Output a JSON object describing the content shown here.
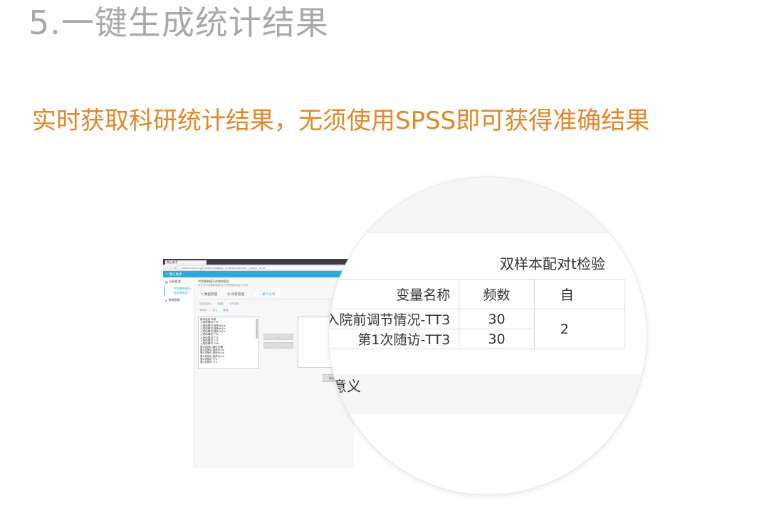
{
  "page": {
    "title": "5.一键生成统计结果",
    "subtitle": "实时获取科研统计结果，无须使用SPSS即可获得准确结果"
  },
  "mini_screenshot": {
    "tab_label": "我心助手",
    "url": "webtest.tscs.org/research/statistic_analysis/research_project_id=90",
    "app_name": "我心助手",
    "sidebar": {
      "items": [
        "科研管理",
        "患者管理"
      ],
      "sub_item": "甲状腺肿瘤不良病例报告"
    },
    "project_title": "甲状腺肿瘤不良病例报告",
    "project_desc": "用于对甲状腺肿瘤患者不良病例情况进行记录",
    "tabs": [
      "数据管理",
      "问卷管理",
      "统计分析"
    ],
    "radios": [
      "描述性统计",
      "t检验",
      "卡方检验"
    ],
    "radios2": [
      "单样本",
      "独立",
      "配对"
    ],
    "variables": [
      "基本信息-年龄",
      "入院前情况-TT3",
      "入院前情况-超声大小a",
      "入院前情况-超声大小b",
      "入院前情况-超声大小c",
      "入院前情况-FT3",
      "入院前情况-FT4",
      "入院前情况-TT4",
      "入院前情况-TSH",
      "第1次随访-随访日期",
      "第1次随访-超声大小a",
      "第1次随访-超声大小b",
      "第1次随访-超声大小c",
      "第1次随访-TT3",
      "第1次随访-TT4"
    ],
    "move_right": "→",
    "move_left": "←",
    "submit": "统计"
  },
  "magnified": {
    "heading": "双样本配对t检验",
    "headers": [
      "变量名称",
      "频数",
      "自"
    ],
    "rows": [
      {
        "name": "入院前调节情况-TT3",
        "count": "30"
      },
      {
        "name": "第1次随访-TT3",
        "count": "30"
      }
    ],
    "merged_value": "2",
    "footer_label": "意义"
  }
}
